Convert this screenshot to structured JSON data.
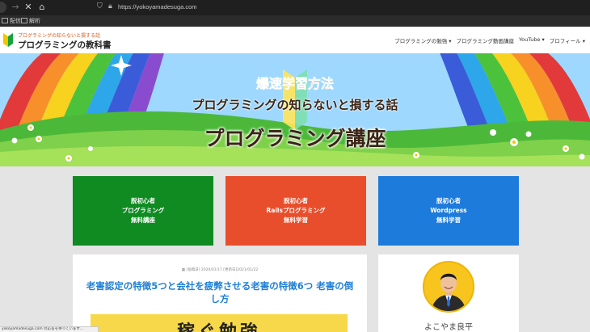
{
  "browser": {
    "url": "https://yokoyamadesuga.com",
    "bookmarks": [
      "配信",
      "解析"
    ]
  },
  "header": {
    "logo_sub": "プログラミングの知らないと損する話",
    "logo_main": "プログラミングの教科書",
    "nav": [
      "プログラミングの勉強 ▾",
      "プログラミング動画講座",
      "YouTube ▾",
      "プロフィール ▾"
    ]
  },
  "hero": {
    "line1": "爆速学習方法",
    "line2": "プログラミングの知らないと損する話",
    "line3": "プログラミング講座"
  },
  "cards": [
    {
      "line1": "脱初心者",
      "line2": "プログラミング",
      "line3": "無料講座",
      "color": "#0f8b22"
    },
    {
      "line1": "脱初心者",
      "line2": "Railsプログラミング",
      "line3": "無料学習",
      "color": "#e84e2c"
    },
    {
      "line1": "脱初心者",
      "line2": "Wordpress",
      "line3": "無料学習",
      "color": "#1d7bdc"
    }
  ],
  "article": {
    "meta": "▦ [投稿日] 2020/01/17 [更新日]2021/01/22",
    "title": "老害認定の特徴5つと会社を疲弊させる老害の特徴6つ 老害の倒し方",
    "thumb_text": "稼ぐ勉強"
  },
  "sidebar": {
    "author_name": "よこやま良平"
  },
  "statusbar": {
    "text": "yokoyamadesuga.com の応答を待っています..."
  }
}
